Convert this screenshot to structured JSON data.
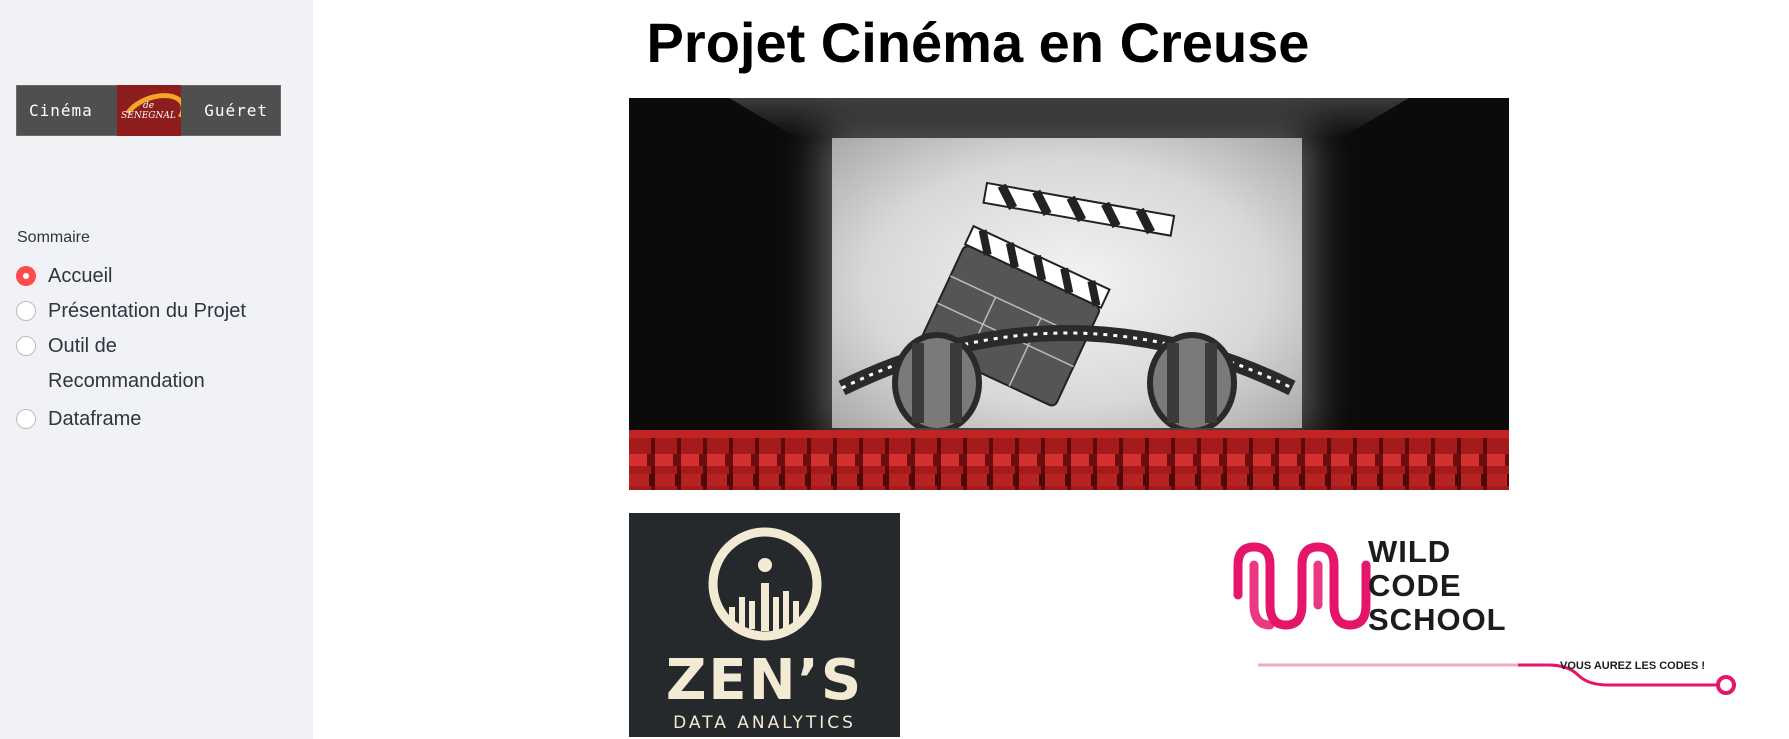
{
  "sidebar": {
    "logo": {
      "left_word": "Cinéma",
      "mark_text_top": "de",
      "mark_text_bottom": "SENEGNAL",
      "right_word": "Guéret"
    },
    "nav_label": "Sommaire",
    "items": [
      {
        "label": "Accueil",
        "selected": true
      },
      {
        "label": "Présentation du Projet",
        "selected": false
      },
      {
        "label": "Outil de\nRecommandation",
        "selected": false
      },
      {
        "label": "Dataframe",
        "selected": false
      }
    ]
  },
  "main": {
    "title": "Projet Cinéma en Creuse",
    "zens_logo": {
      "name": "ZEN’S",
      "subtitle": "DATA ANALYTICS"
    },
    "wcs_logo": {
      "line1": "WILD",
      "line2": "CODE",
      "line3": "SCHOOL",
      "tagline": "VOUS AUREZ LES CODES !"
    }
  },
  "colors": {
    "accent": "#ff4b4b",
    "sidebar_bg": "#f0f2f6",
    "wcs_pink": "#e5166a"
  }
}
